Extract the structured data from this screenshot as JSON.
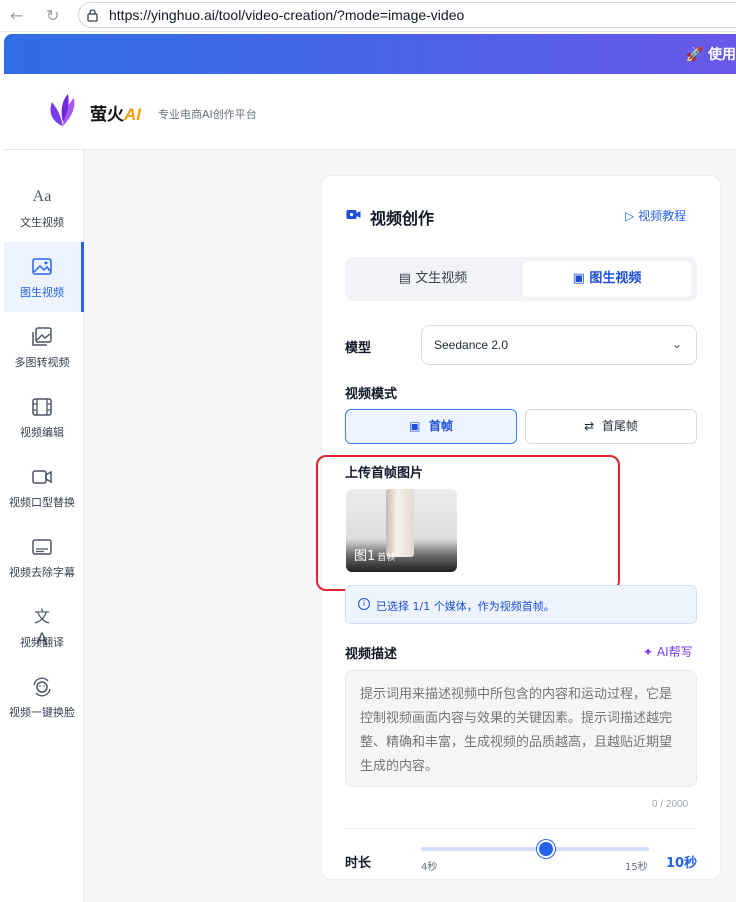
{
  "browser": {
    "back_icon": "arrow-left-icon",
    "reload_icon": "reload-icon",
    "url": "https://yinghuo.ai/tool/video-creation/?mode=image-video"
  },
  "banner": {
    "text": "🚀 使用",
    "icon": "rocket-icon"
  },
  "header": {
    "brand_prefix": "萤火",
    "brand_suffix": "AI",
    "tagline": "专业电商AI创作平台"
  },
  "sidebar": {
    "items": [
      {
        "label": "文生视频",
        "icon": "text-aa-icon"
      },
      {
        "label": "图生视频",
        "icon": "image-icon",
        "active": true
      },
      {
        "label": "多图转视频",
        "icon": "images-icon"
      },
      {
        "label": "视频编辑",
        "icon": "film-icon"
      },
      {
        "label": "视频口型替换",
        "icon": "camera-icon"
      },
      {
        "label": "视频去除字幕",
        "icon": "subtitle-icon"
      },
      {
        "label": "视频翻译",
        "icon": "translate-icon"
      },
      {
        "label": "视频一键换脸",
        "icon": "face-swap-icon"
      }
    ]
  },
  "panel": {
    "title": "视频创作",
    "tutorial": "视频教程",
    "tabs": [
      {
        "label": "文生视频",
        "icon": "document-icon"
      },
      {
        "label": "图生视频",
        "icon": "image-icon",
        "active": true
      }
    ],
    "model_label": "模型",
    "model_value": "Seedance 2.0",
    "mode_label": "视频模式",
    "modes": [
      {
        "label": "首帧",
        "icon": "frame-icon",
        "active": true
      },
      {
        "label": "首尾帧",
        "icon": "swap-icon"
      }
    ],
    "upload_label": "上传首帧图片",
    "thumb_label": "图1",
    "thumb_sub": "首帧",
    "info_text": "已选择 1/1 个媒体，作为视频首帧。",
    "desc_label": "视频描述",
    "ai_help": "AI帮写",
    "desc_placeholder": "提示词用来描述视频中所包含的内容和运动过程，它是控制视频画面内容与效果的关键因素。提示词描述越完整、精确和丰富，生成视频的品质越高，且越贴近期望生成的内容。",
    "counter": "0 / 2000",
    "duration_label": "时长",
    "duration_min": "4秒",
    "duration_max": "15秒",
    "duration_value": "10秒",
    "duration_fraction": 0.55
  },
  "colors": {
    "accent": "#2563eb",
    "highlight": "#e0242e",
    "brand_ai": "#f59e0b",
    "ai_help": "#7c3aed"
  }
}
